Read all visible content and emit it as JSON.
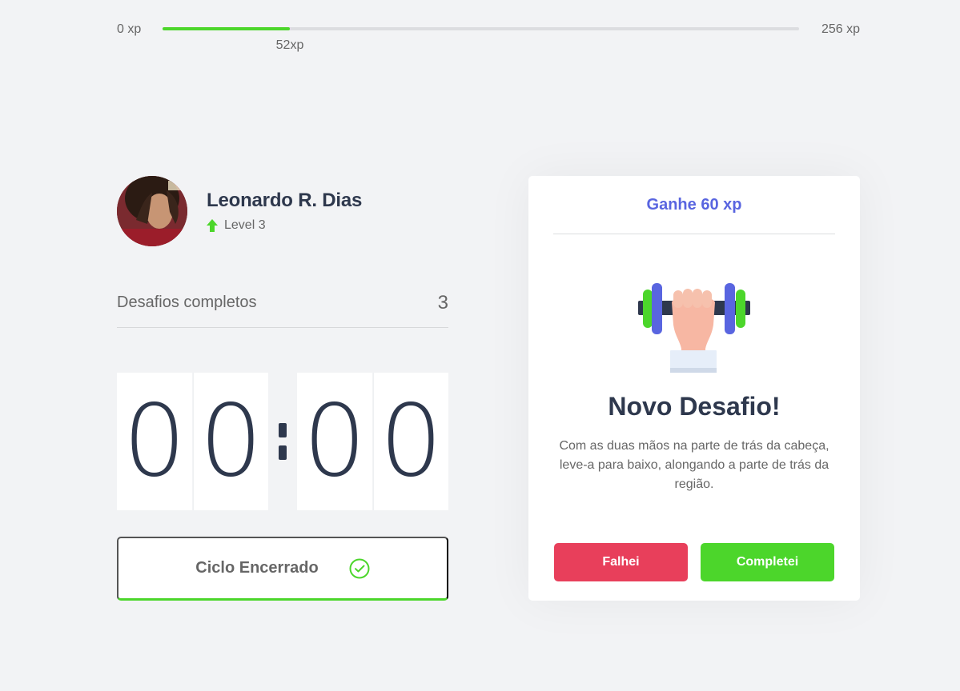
{
  "xp": {
    "min_label": "0 xp",
    "max_label": "256 xp",
    "current_label": "52xp",
    "progress_fraction": 0.2
  },
  "profile": {
    "name": "Leonardo R. Dias",
    "level": "Level 3"
  },
  "stats": {
    "completed_label": "Desafios completos",
    "completed_value": "3"
  },
  "countdown": {
    "minutes": [
      "0",
      "0"
    ],
    "seconds": [
      "0",
      "0"
    ]
  },
  "cycle": {
    "label": "Ciclo Encerrado"
  },
  "challenge": {
    "gain": "Ganhe 60 xp",
    "title": "Novo Desafio!",
    "description": "Com as duas mãos na parte de trás da cabeça, leve-a para baixo, alongando a parte de trás da região.",
    "fail_label": "Falhei",
    "complete_label": "Completei"
  },
  "colors": {
    "background": "#f2f3f5",
    "text": "#666666",
    "title": "#2e384d",
    "green": "#4cd62b",
    "red": "#e83f5b",
    "blue": "#5965e0"
  },
  "icons": {
    "level": "level-up-arrow-icon",
    "cycle": "check-circle-icon",
    "challenge": "dumbbell-icon"
  }
}
